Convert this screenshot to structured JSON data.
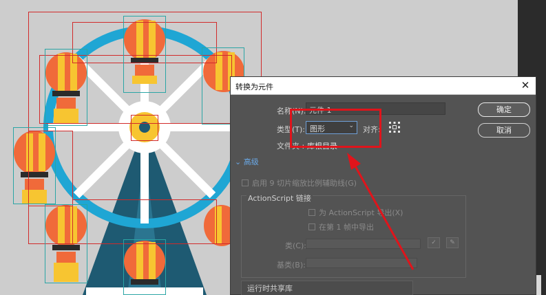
{
  "dialog": {
    "title": "转换为元件",
    "close_glyph": "✕",
    "name_label": "名称(N):",
    "name_value": "元件 1",
    "type_label": "类型(T):",
    "type_value": "图形",
    "type_chevron": "⌄",
    "align_label": "对齐:",
    "folder_label": "文件夹 :",
    "folder_value": "库根目录",
    "ok_label": "确定",
    "cancel_label": "取消",
    "advanced_label": "高级",
    "advanced_chevron": "⌄",
    "scale9_label": "启用 9 切片缩放比例辅助线(G)",
    "actionscript_group": "ActionScript 链接",
    "export_as_label": "为 ActionScript 导出(X)",
    "export_frame1_label": "在第 1 帧中导出",
    "class_label": "类(C):",
    "base_class_label": "基类(B):",
    "runtime_shared_label": "运行时共享库"
  },
  "colors": {
    "annotation": "#e0141b",
    "selection_red": "#d12a2a",
    "selection_teal": "#2aa5a5",
    "wheel_blue": "#1fa6d4",
    "balloon_orange": "#f06a3a",
    "balloon_yellow": "#f7c531",
    "tower_dark": "#1e5a72"
  },
  "icons": {
    "close": "close-icon",
    "chevron": "chevron-down-icon",
    "align": "registration-grid-icon",
    "pencil": "pencil-icon",
    "checkmark": "check-icon"
  }
}
